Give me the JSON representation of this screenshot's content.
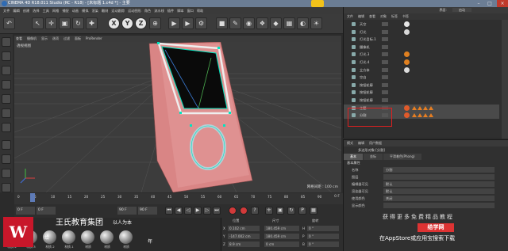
{
  "window": {
    "title": "CINEMA 4D R18.011 Studio (RC - R18) - [未标题 1.c4d *] - 主要"
  },
  "menubar": [
    "文件",
    "编辑",
    "创建",
    "选择",
    "工具",
    "网格",
    "捕捉",
    "动画",
    "模拟",
    "渲染",
    "雕刻",
    "运动跟踪",
    "运动图形",
    "角色",
    "流水线",
    "插件",
    "脚本",
    "窗口",
    "帮助"
  ],
  "toolbar": {
    "axis_x": "X",
    "axis_y": "Y",
    "axis_z": "Z"
  },
  "viewport": {
    "menu": [
      "查看",
      "摄像机",
      "显示",
      "选项",
      "过滤",
      "面板",
      "ProRender"
    ],
    "label": "透视视图",
    "grid_info": "网格间距 : 100 cm"
  },
  "object_manager": {
    "menu": [
      "文件",
      "编辑",
      "查看",
      "对象",
      "标签",
      "书签"
    ],
    "layout_label": "界面:",
    "layout_value": "启动",
    "rows": [
      {
        "name": "天空"
      },
      {
        "name": "灯光"
      },
      {
        "name": "灯光目标.1"
      },
      {
        "name": "摄像机"
      },
      {
        "name": "灯光.3"
      },
      {
        "name": "灯光.4"
      },
      {
        "name": "立方体"
      },
      {
        "name": "空白"
      },
      {
        "name": "按钮轮廓"
      },
      {
        "name": "按钮轮廓"
      },
      {
        "name": "按钮轮廓"
      },
      {
        "name": "主题"
      },
      {
        "name": "分割"
      }
    ]
  },
  "attributes": {
    "menu": [
      "模式",
      "编辑",
      "用户数据"
    ],
    "object_title": "多边形对象 [分割]",
    "tabs": [
      "基本",
      "坐标",
      "平滑着色(Phong)"
    ],
    "section": "基本属性",
    "fields": [
      {
        "label": "名称",
        "value": "分割"
      },
      {
        "label": "图层",
        "value": ""
      },
      {
        "label": "编辑器可见",
        "value": "默认"
      },
      {
        "label": "渲染器可见",
        "value": "默认"
      },
      {
        "label": "使用颜色",
        "value": "关闭"
      },
      {
        "label": "显示颜色",
        "value": ""
      }
    ]
  },
  "timeline": {
    "ticks": [
      "0",
      "5",
      "10",
      "15",
      "20",
      "25",
      "30",
      "35",
      "40",
      "45",
      "50",
      "55",
      "60",
      "65",
      "70",
      "75",
      "80",
      "85",
      "90"
    ],
    "end_label": "0 F"
  },
  "transport": {
    "start": "0 F",
    "current": "0 F",
    "end": "90 F",
    "end2": "90 F"
  },
  "materials": {
    "labels": [
      "材质.4",
      "材质.3",
      "材质.2",
      "材质.1",
      "材质",
      "材质",
      "材质"
    ]
  },
  "coordinates": {
    "headers": [
      "位置",
      "尺寸",
      "旋转"
    ],
    "rows": [
      {
        "axis": "X",
        "pos": "0.102 cm",
        "size": "180.459 cm",
        "rot_label": "H",
        "rot": "0 °"
      },
      {
        "axis": "Y",
        "pos": "-147.002 cm",
        "size": "180.459 cm",
        "rot_label": "P",
        "rot": "0 °"
      },
      {
        "axis": "Z",
        "pos": "8.9 cm",
        "size": "0 cm",
        "rot_label": "B",
        "rot": "0 °"
      }
    ]
  },
  "watermark_brand": {
    "logo_letter": "W",
    "name": "王氏教育集团",
    "motto": "以人为本",
    "year": "年",
    "slogan_mid": "给"
  },
  "watermark_promo": {
    "top": "获得更多免费精品教程",
    "badge": "给学网",
    "bottom": "在AppStore或应用宝搜索下载"
  },
  "colors": {
    "title_bar": "#6b7d94",
    "viewport_bg": "#3c3c3c",
    "phone_body": "#d98585",
    "selection_outline": "#00e5c0",
    "highlight_box": "#e02020",
    "brand_red": "#c8172a"
  }
}
